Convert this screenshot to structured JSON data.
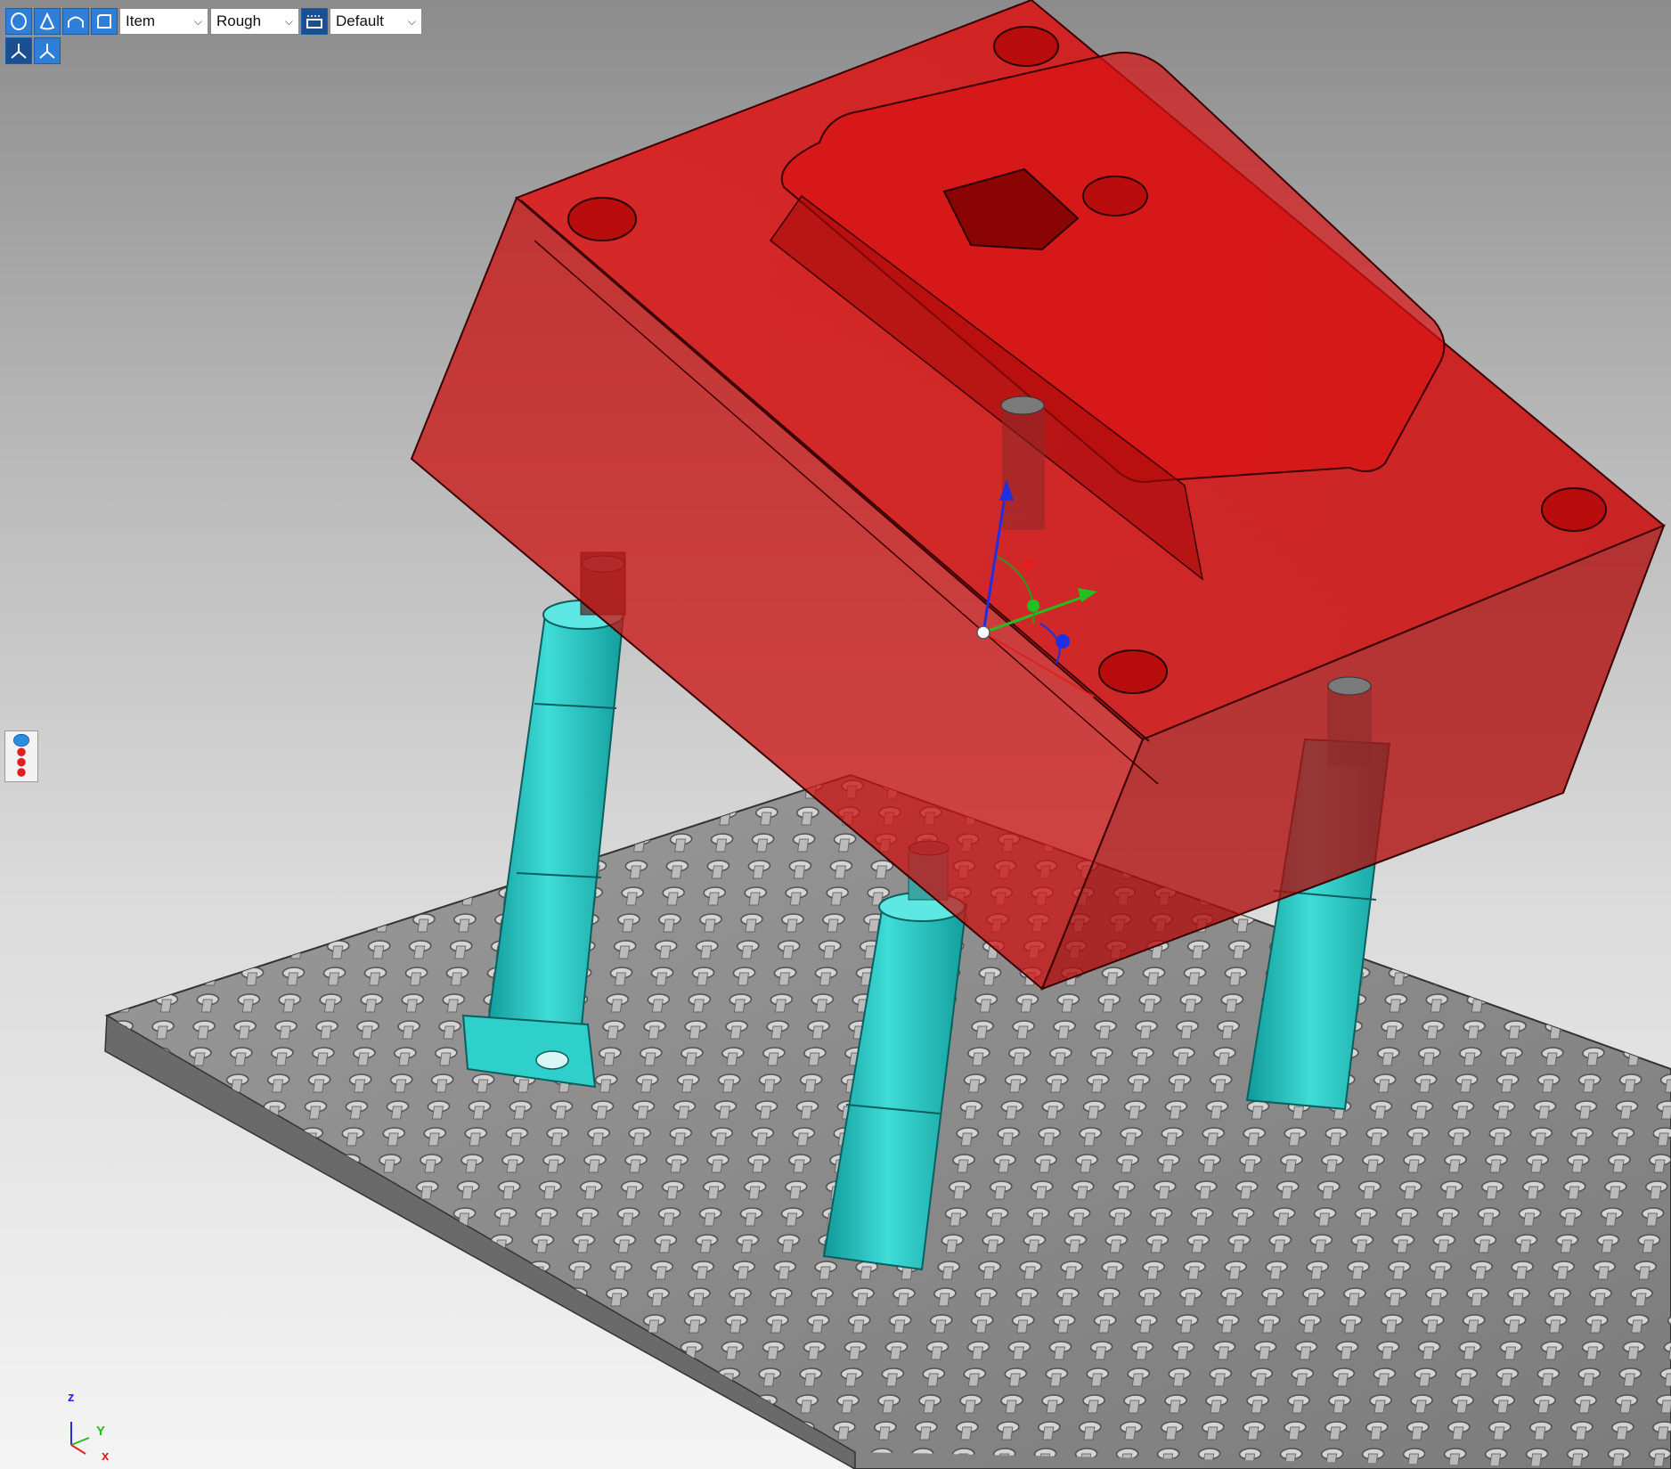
{
  "toolbar": {
    "filter_value": "Item",
    "quality_value": "Rough",
    "view_value": "Default",
    "icons": [
      "sphere-view-icon",
      "cone-view-icon",
      "arch-view-icon",
      "box-view-icon",
      "display-settings-icon",
      "axis-left-icon",
      "axis-right-icon"
    ]
  },
  "triad": {
    "z_label": "z",
    "y_label": "Y",
    "x_label": "x"
  },
  "colors": {
    "mold_red": "#e01010",
    "fixture_cyan": "#22c7c4",
    "plate_gray": "#8a8a8a",
    "toolbar_blue": "#2f7fd8",
    "axis_x": "#e02020",
    "axis_y": "#20c020",
    "axis_z": "#2030e0"
  },
  "scene": {
    "description_items": [
      "mold-block",
      "fixture-plate",
      "support-column",
      "manipulator-triad"
    ]
  }
}
